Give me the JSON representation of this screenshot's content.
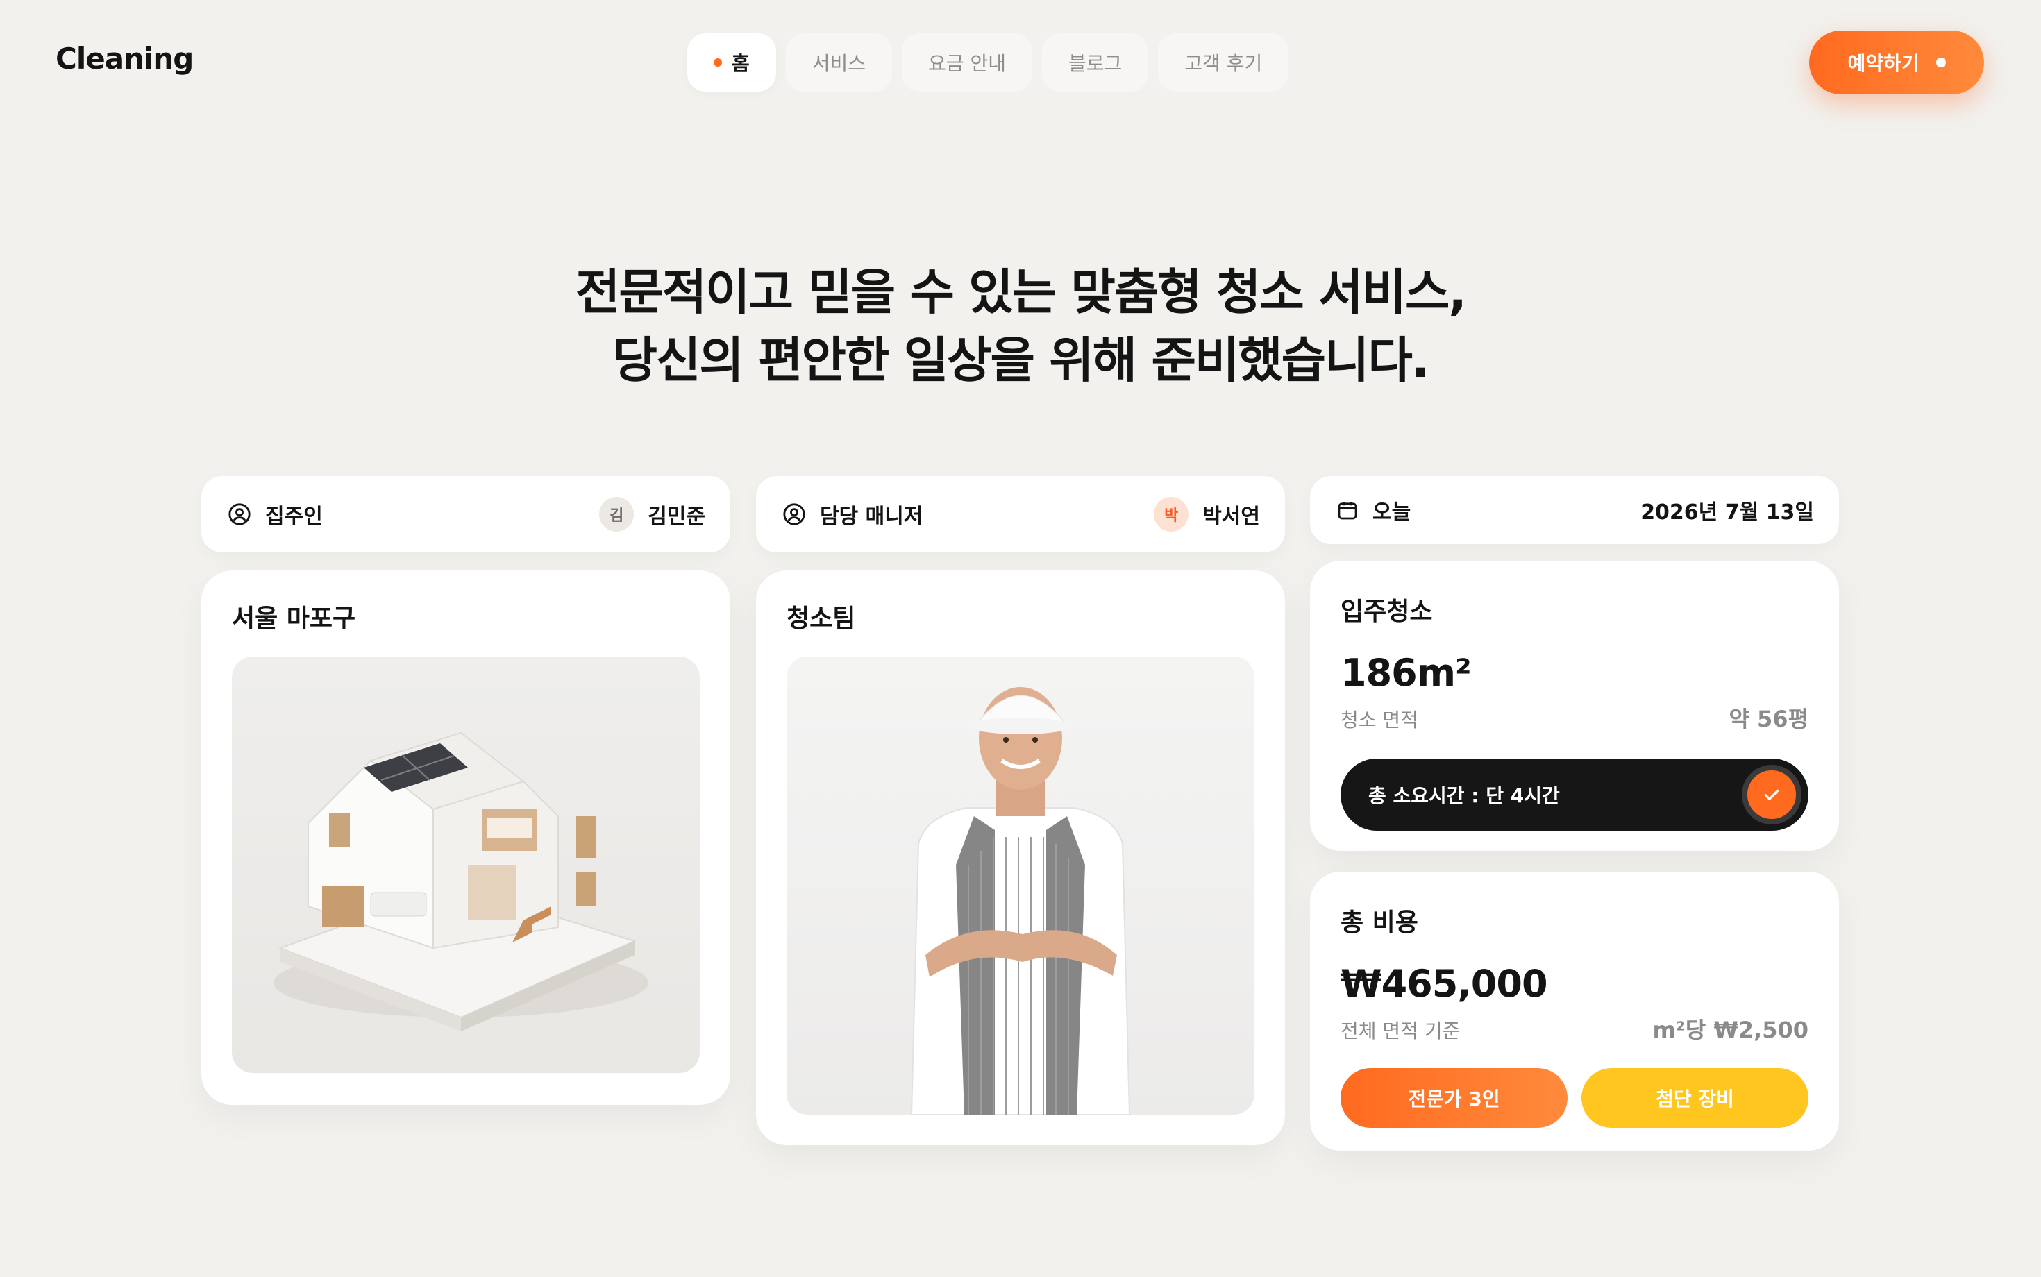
{
  "header": {
    "brand": "Cleaning",
    "nav": [
      {
        "label": "홈",
        "active": true
      },
      {
        "label": "서비스",
        "active": false
      },
      {
        "label": "요금 안내",
        "active": false
      },
      {
        "label": "블로그",
        "active": false
      },
      {
        "label": "고객 후기",
        "active": false
      }
    ],
    "cta_label": "예약하기"
  },
  "hero": {
    "line1": "전문적이고 믿을 수 있는 맞춤형 청소 서비스,",
    "line2": "당신의 편안한 일상을 위해 준비했습니다."
  },
  "owner": {
    "label": "집주인",
    "avatar_initial": "김",
    "name": "김민준"
  },
  "manager": {
    "label": "담당 매니저",
    "avatar_initial": "박",
    "name": "박서연"
  },
  "today": {
    "label": "오늘",
    "date": "2026년 7월 13일"
  },
  "location_card": {
    "title": "서울 마포구"
  },
  "team_card": {
    "title": "청소팀"
  },
  "area_card": {
    "title": "입주청소",
    "value": "186m²",
    "sub_label": "청소 면적",
    "side_value": "약 56평",
    "time_text": "총 소요시간 : 단 4시간"
  },
  "cost_card": {
    "title": "총 비용",
    "value": "₩465,000",
    "sub_label": "전체 면적 기준",
    "side_value": "m²당 ₩2,500",
    "button1": "전문가 3인",
    "button2": "첨단 장비"
  },
  "colors": {
    "accent": "#ff6a1f",
    "yellow": "#ffc620",
    "background": "#f2f1ee",
    "dark": "#161616"
  },
  "icons": [
    "user-circle-icon",
    "calendar-icon",
    "check-icon"
  ]
}
